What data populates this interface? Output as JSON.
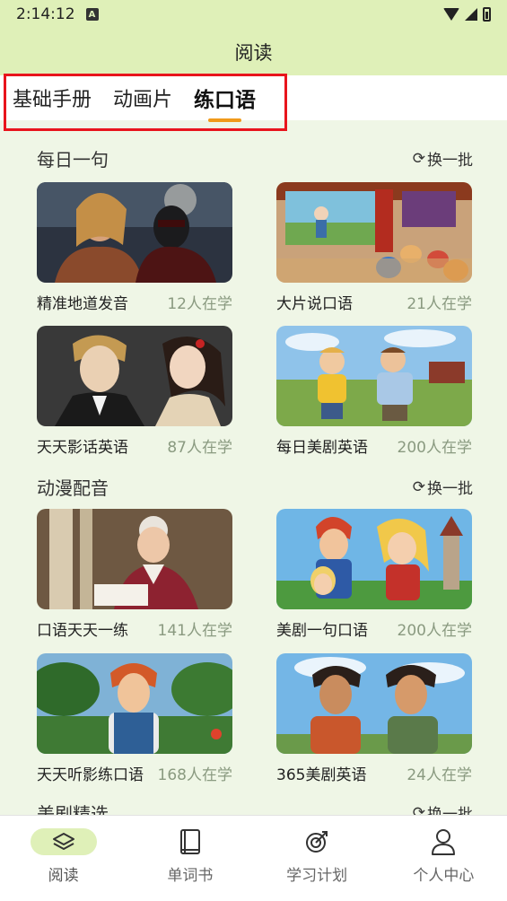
{
  "status_bar": {
    "time": "2:14:12",
    "sim_label": "A"
  },
  "header": {
    "title": "阅读"
  },
  "tabs": [
    {
      "label": "基础手册",
      "active": false
    },
    {
      "label": "动画片",
      "active": false
    },
    {
      "label": "练口语",
      "active": true
    }
  ],
  "sections": [
    {
      "title": "每日一句",
      "refresh_label": "换一批",
      "cards": [
        {
          "title": "精准地道发音",
          "count": "12人在学"
        },
        {
          "title": "大片说口语",
          "count": "21人在学"
        },
        {
          "title": "天天影话英语",
          "count": "87人在学"
        },
        {
          "title": "每日美剧英语",
          "count": "200人在学"
        }
      ]
    },
    {
      "title": "动漫配音",
      "refresh_label": "换一批",
      "cards": [
        {
          "title": "口语天天一练",
          "count": "141人在学"
        },
        {
          "title": "美剧一句口语",
          "count": "200人在学"
        },
        {
          "title": "天天听影练口语",
          "count": "168人在学"
        },
        {
          "title": "365美剧英语",
          "count": "24人在学"
        }
      ]
    },
    {
      "title": "美剧精选",
      "refresh_label": "换一批"
    }
  ],
  "bottom_nav": [
    {
      "label": "阅读",
      "icon": "layers-icon",
      "active": true
    },
    {
      "label": "单词书",
      "icon": "book-icon",
      "active": false
    },
    {
      "label": "学习计划",
      "icon": "target-icon",
      "active": false
    },
    {
      "label": "个人中心",
      "icon": "person-icon",
      "active": false
    }
  ],
  "colors": {
    "accent": "#f09a1a",
    "header_bg": "#dff0b8",
    "page_bg": "#eff6e6",
    "highlight": "#e8141c"
  }
}
